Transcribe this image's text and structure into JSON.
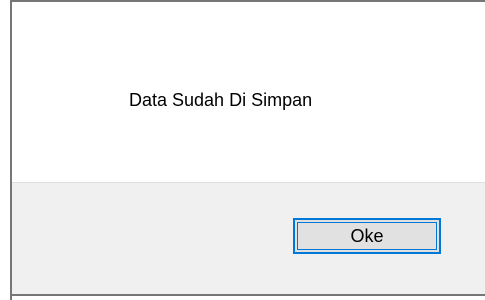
{
  "dialog": {
    "message": "Data Sudah Di Simpan",
    "ok_label": "Oke"
  },
  "colors": {
    "frame": "#767676",
    "button_bar": "#f0f0f0",
    "button_face": "#e1e1e1",
    "focus_border": "#0078d7"
  }
}
